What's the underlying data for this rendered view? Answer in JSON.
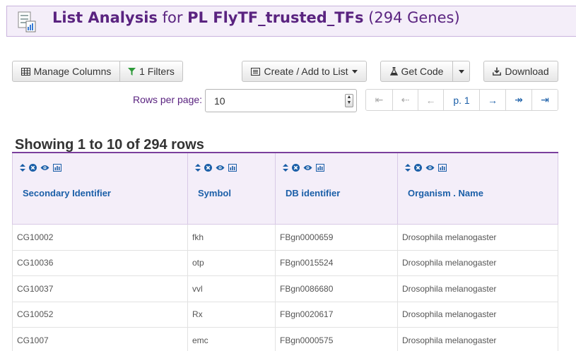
{
  "header": {
    "title_bold": "List Analysis",
    "title_for": "for",
    "list_name": "PL FlyTF_trusted_TFs",
    "gene_count": "(294 Genes)",
    "list_icon": "list-chart-icon"
  },
  "toolbar": {
    "manage_columns": "Manage Columns",
    "filters": "1 Filters",
    "create_list": "Create / Add to List",
    "get_code": "Get Code",
    "download": "Download"
  },
  "pagination": {
    "rows_per_page_label": "Rows per page:",
    "rows_per_page_value": "10",
    "buttons": [
      "⇤",
      "⇠",
      "←",
      "p. 1",
      "→",
      "↠",
      "⇥"
    ]
  },
  "showing_text": "Showing 1 to 10 of 294 rows",
  "table": {
    "columns": [
      "Secondary Identifier",
      "Symbol",
      "DB identifier",
      "Organism . Name"
    ],
    "rows": [
      [
        "CG10002",
        "fkh",
        "FBgn0000659",
        "Drosophila melanogaster"
      ],
      [
        "CG10036",
        "otp",
        "FBgn0015524",
        "Drosophila melanogaster"
      ],
      [
        "CG10037",
        "vvl",
        "FBgn0086680",
        "Drosophila melanogaster"
      ],
      [
        "CG10052",
        "Rx",
        "FBgn0020617",
        "Drosophila melanogaster"
      ],
      [
        "CG1007",
        "emc",
        "FBgn0000575",
        "Drosophila melanogaster"
      ]
    ]
  },
  "colors": {
    "header_bg": "#f4eef9",
    "brand_purple": "#5a2380",
    "link_blue": "#1b5fa8"
  }
}
